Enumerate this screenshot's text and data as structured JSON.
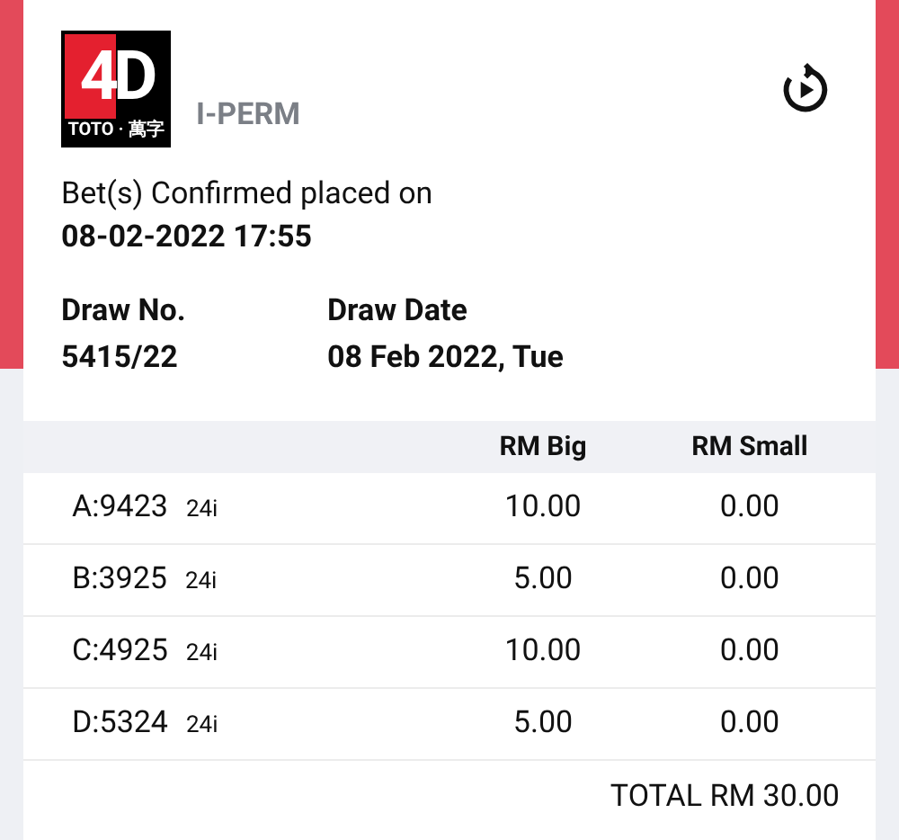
{
  "logo": {
    "main": "4D",
    "band": "TOTO · 萬字"
  },
  "product": "I-PERM",
  "confirm_text": "Bet(s) Confirmed placed on",
  "confirm_time": "08-02-2022 17:55",
  "draw": [
    {
      "label": "Draw No.",
      "value": "5415/22"
    },
    {
      "label": "Draw Date",
      "value": "08 Feb 2022, Tue"
    }
  ],
  "table": {
    "columns": [
      "RM Big",
      "RM Small"
    ],
    "rows": [
      {
        "number": "A:9423",
        "tag": "24i",
        "big": "10.00",
        "small": "0.00"
      },
      {
        "number": "B:3925",
        "tag": "24i",
        "big": "5.00",
        "small": "0.00"
      },
      {
        "number": "C:4925",
        "tag": "24i",
        "big": "10.00",
        "small": "0.00"
      },
      {
        "number": "D:5324",
        "tag": "24i",
        "big": "5.00",
        "small": "0.00"
      }
    ]
  },
  "total": "TOTAL RM 30.00"
}
